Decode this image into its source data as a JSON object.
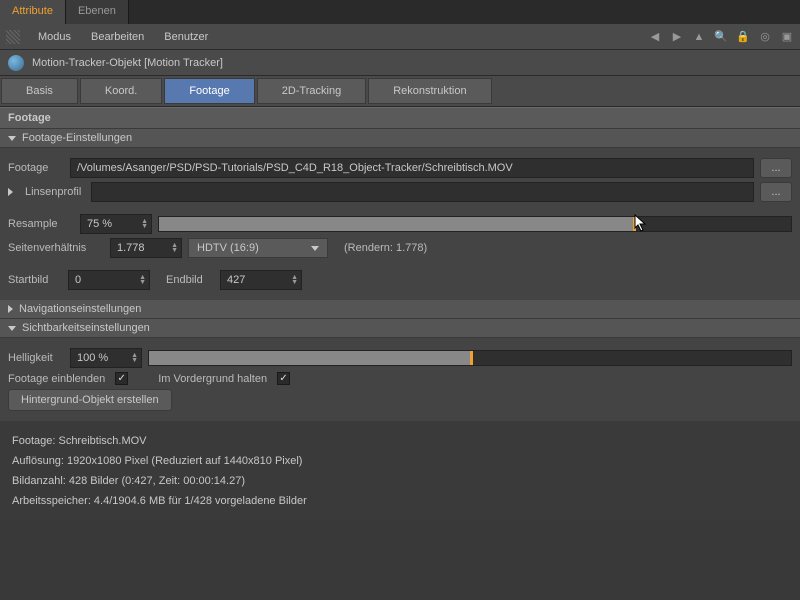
{
  "topTabs": {
    "attribute": "Attribute",
    "ebenen": "Ebenen"
  },
  "menu": {
    "modus": "Modus",
    "bearbeiten": "Bearbeiten",
    "benutzer": "Benutzer"
  },
  "object": {
    "title": "Motion-Tracker-Objekt [Motion Tracker]"
  },
  "tabs": {
    "basis": "Basis",
    "koord": "Koord.",
    "footage": "Footage",
    "tracking2d": "2D-Tracking",
    "rekonstruktion": "Rekonstruktion"
  },
  "sections": {
    "footage": "Footage",
    "footageSettings": "Footage-Einstellungen",
    "nav": "Navigationseinstellungen",
    "visibility": "Sichtbarkeitseinstellungen"
  },
  "labels": {
    "footage": "Footage",
    "linsenprofil": "Linsenprofil",
    "resample": "Resample",
    "seitenverhaeltnis": "Seitenverhältnis",
    "startbild": "Startbild",
    "endbild": "Endbild",
    "helligkeit": "Helligkeit",
    "footageEinblenden": "Footage einblenden",
    "imVordergrund": "Im Vordergrund halten",
    "rendern": "(Rendern: 1.778)"
  },
  "values": {
    "footagePath": "/Volumes/Asanger/PSD/PSD-Tutorials/PSD_C4D_R18_Object-Tracker/Schreibtisch.MOV",
    "resample": "75 %",
    "resamplePct": 75,
    "seitenverhaeltnis": "1.778",
    "hdtv": "HDTV (16:9)",
    "startbild": "0",
    "endbild": "427",
    "helligkeit": "100 %",
    "helligkeitPct": 60
  },
  "buttons": {
    "hintergrund": "Hintergrund-Objekt erstellen",
    "dots": "..."
  },
  "info": {
    "l1": "Footage: Schreibtisch.MOV",
    "l2": "Auflösung: 1920x1080 Pixel (Reduziert auf 1440x810 Pixel)",
    "l3": "Bildanzahl: 428 Bilder (0:427, Zeit: 00:00:14.27)",
    "l4": "Arbeitsspeicher: 4.4/1904.6 MB für 1/428 vorgeladene Bilder"
  }
}
